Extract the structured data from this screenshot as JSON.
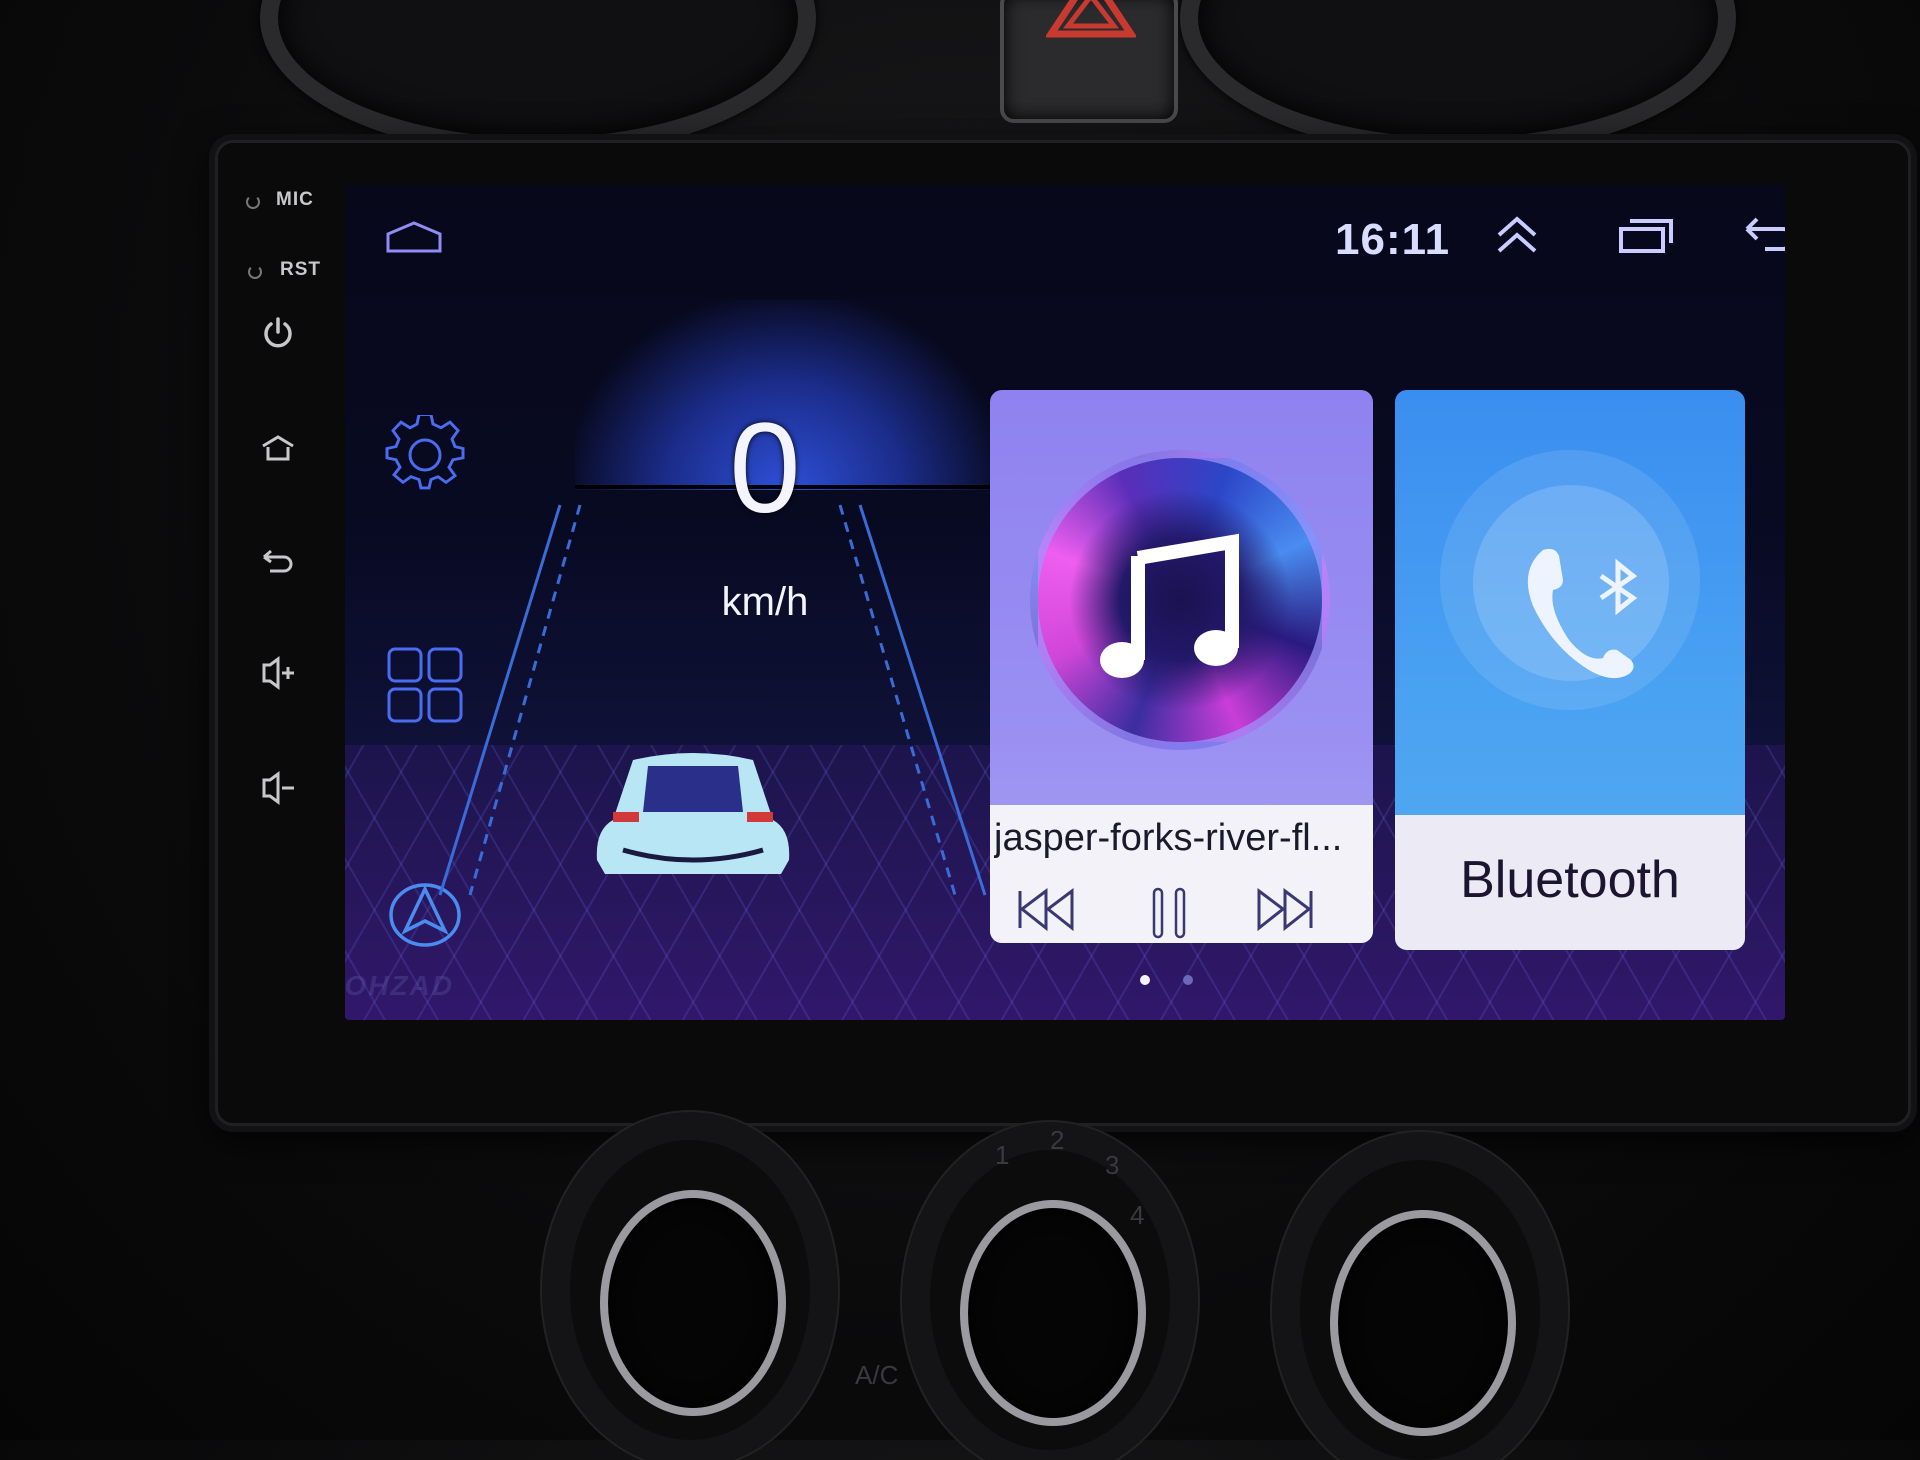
{
  "device": {
    "hardware_buttons": {
      "mic_label": "MIC",
      "rst_label": "RST",
      "buttons": [
        {
          "name": "power",
          "icon": "power-icon"
        },
        {
          "name": "home",
          "icon": "home-icon"
        },
        {
          "name": "back",
          "icon": "back-icon"
        },
        {
          "name": "volume-up",
          "icon": "volume-up-icon"
        },
        {
          "name": "volume-down",
          "icon": "volume-down-icon"
        }
      ]
    },
    "climate_labels": {
      "fan_speeds": [
        "1",
        "2",
        "3",
        "4"
      ],
      "ac": "A/C"
    }
  },
  "status_bar": {
    "time": "16:11",
    "icons": [
      "home-icon",
      "expand-up-icon",
      "recent-apps-icon",
      "back-icon"
    ]
  },
  "dock": {
    "items": [
      {
        "label": "Settings",
        "icon": "gear-icon"
      },
      {
        "label": "Apps",
        "icon": "app-grid-icon"
      },
      {
        "label": "Navigation",
        "icon": "navigation-icon"
      }
    ]
  },
  "speedometer": {
    "value": "0",
    "unit": "km/h"
  },
  "music_card": {
    "track_title": "jasper-forks-river-fl...",
    "state": "playing",
    "controls": [
      "previous",
      "pause",
      "next"
    ]
  },
  "bluetooth_card": {
    "label": "Bluetooth"
  },
  "pager": {
    "pages": 2,
    "current": 1
  },
  "colors": {
    "accent_blue": "#4a6cf0",
    "icon_outline": "#8f8cf6",
    "music_card_bg": "#9a8ff2",
    "bt_card_bg": "#4aa2f2",
    "card_footer": "#f3f2f8"
  }
}
